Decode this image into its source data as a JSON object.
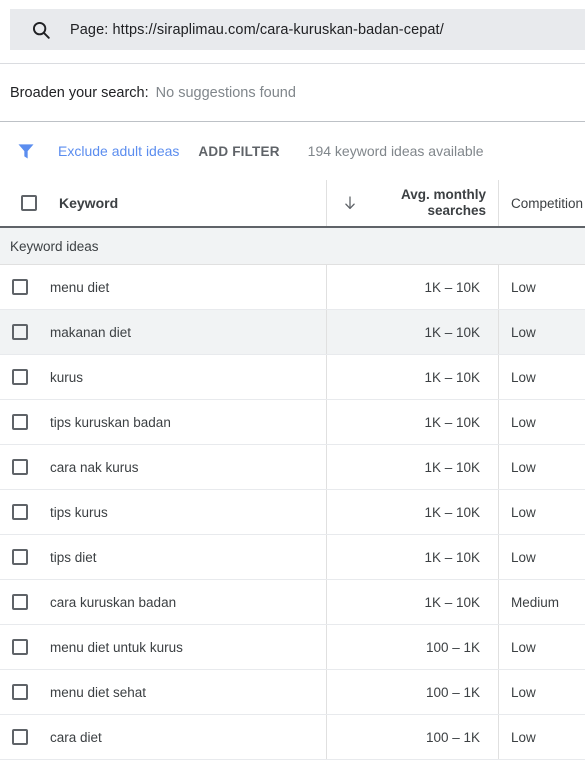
{
  "search": {
    "icon": "search-icon",
    "text": "Page: https://siraplimau.com/cara-kuruskan-badan-cepat/"
  },
  "broaden": {
    "label": "Broaden your search:",
    "value": "No suggestions found"
  },
  "filter_bar": {
    "icon": "filter-funnel-icon",
    "exclude_label": "Exclude adult ideas",
    "add_filter_label": "ADD FILTER",
    "ideas_count": "194 keyword ideas available",
    "link_color": "#5b8def"
  },
  "table": {
    "columns": {
      "keyword": "Keyword",
      "avg_monthly_searches_line1": "Avg. monthly",
      "avg_monthly_searches_line2": "searches",
      "competition": "Competition"
    },
    "sort_icon": "arrow-down-icon",
    "group_label": "Keyword ideas",
    "rows": [
      {
        "keyword": "menu diet",
        "volume": "1K – 10K",
        "competition": "Low",
        "shaded": false
      },
      {
        "keyword": "makanan diet",
        "volume": "1K – 10K",
        "competition": "Low",
        "shaded": true
      },
      {
        "keyword": "kurus",
        "volume": "1K – 10K",
        "competition": "Low",
        "shaded": false
      },
      {
        "keyword": "tips kuruskan badan",
        "volume": "1K – 10K",
        "competition": "Low",
        "shaded": false
      },
      {
        "keyword": "cara nak kurus",
        "volume": "1K – 10K",
        "competition": "Low",
        "shaded": false
      },
      {
        "keyword": "tips kurus",
        "volume": "1K – 10K",
        "competition": "Low",
        "shaded": false
      },
      {
        "keyword": "tips diet",
        "volume": "1K – 10K",
        "competition": "Low",
        "shaded": false
      },
      {
        "keyword": "cara kuruskan badan",
        "volume": "1K – 10K",
        "competition": "Medium",
        "shaded": false
      },
      {
        "keyword": "menu diet untuk kurus",
        "volume": "100 – 1K",
        "competition": "Low",
        "shaded": false
      },
      {
        "keyword": "menu diet sehat",
        "volume": "100 – 1K",
        "competition": "Low",
        "shaded": false
      },
      {
        "keyword": "cara diet",
        "volume": "100 – 1K",
        "competition": "Low",
        "shaded": false
      }
    ]
  }
}
